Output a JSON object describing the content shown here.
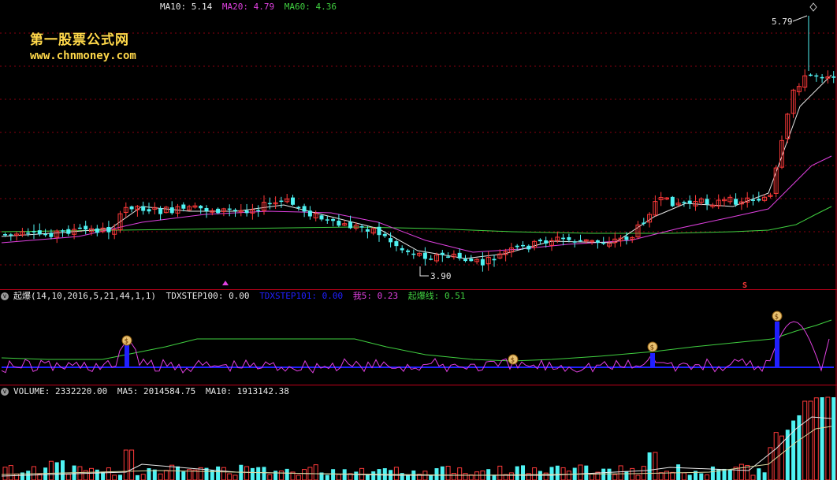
{
  "watermark": {
    "title": "第一股票公式网",
    "url": "www.chnmoney.com"
  },
  "main_panel": {
    "ma_labels": [
      {
        "name": "MA10",
        "value": "5.14",
        "color": "#e8e8e8"
      },
      {
        "name": "MA20",
        "value": "4.79",
        "color": "#e040e0"
      },
      {
        "name": "MA60",
        "value": "4.36",
        "color": "#40d040"
      }
    ],
    "price_high_label": "5.79",
    "price_low_label": "3.90",
    "signal_markers": {
      "left": "triangle-up-marker",
      "right": "s-marker",
      "right_text": "S"
    }
  },
  "indicator_panel": {
    "name": "起爆",
    "params": "(14,10,2016,5,21,44,1,1)",
    "values": [
      {
        "name": "TDXSTEP100",
        "value": "0.00",
        "color": "#e8e8e8"
      },
      {
        "name": "TDXSTEP101",
        "value": "0.00",
        "color": "#2020ff"
      },
      {
        "name": "我5",
        "value": "0.23",
        "color": "#e040e0"
      },
      {
        "name": "起爆线",
        "value": "0.51",
        "color": "#40d040"
      }
    ],
    "money_bag_icon": "money-bag-icon"
  },
  "volume_panel": {
    "values": [
      {
        "name": "VOLUME",
        "value": "2332220.00",
        "color": "#e8e8e8"
      },
      {
        "name": "MA5",
        "value": "2014584.75",
        "color": "#e8e8e8"
      },
      {
        "name": "MA10",
        "value": "1913142.38",
        "color": "#e8e8e8"
      }
    ]
  },
  "colors": {
    "up": "#ff3a3a",
    "down": "#4ff2f2",
    "ma10": "#e8e8e8",
    "ma20": "#e040e0",
    "ma60": "#40d040",
    "grid": "#8a0010",
    "accent_blue": "#2020ff",
    "watermark": "#ffd84a"
  },
  "chart_data": {
    "type": "candlestick",
    "series": [
      {
        "name": "MA10",
        "value": 5.14
      },
      {
        "name": "MA20",
        "value": 4.79
      },
      {
        "name": "MA60",
        "value": 4.36
      }
    ],
    "annotations": {
      "high": 5.79,
      "low": 3.9
    },
    "indicator": {
      "TDXSTEP100": 0.0,
      "TDXSTEP101": 0.0,
      "我5": 0.23,
      "起爆线": 0.51
    },
    "volume": {
      "VOLUME": 2332220.0,
      "MA5": 2014584.75,
      "MA10": 1913142.38
    }
  }
}
